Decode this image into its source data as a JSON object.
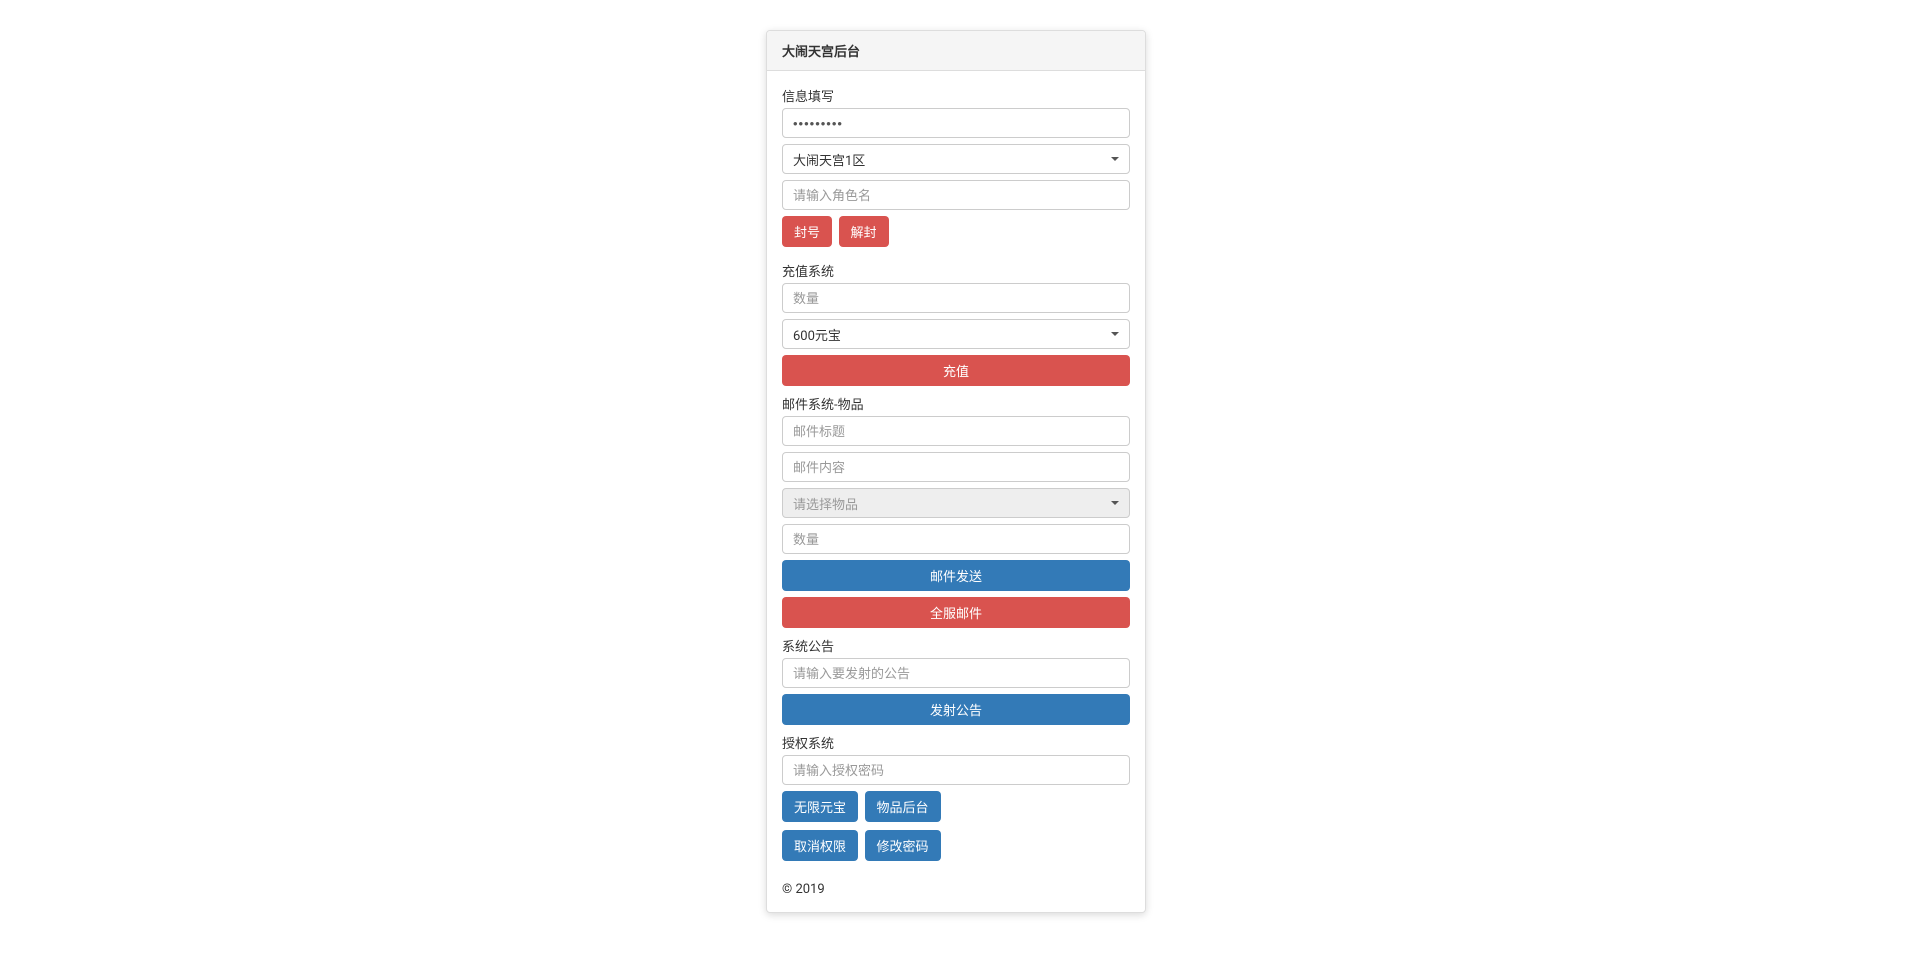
{
  "header": {
    "title": "大闹天宫后台"
  },
  "info_section": {
    "label": "信息填写",
    "password_value": "•••••••••",
    "server_select": "大闹天宫1区",
    "character_placeholder": "请输入角色名",
    "ban_button": "封号",
    "unban_button": "解封"
  },
  "recharge_section": {
    "label": "充值系统",
    "amount_placeholder": "数量",
    "package_select": "600元宝",
    "recharge_button": "充值"
  },
  "mail_section": {
    "label": "邮件系统-物品",
    "title_placeholder": "邮件标题",
    "content_placeholder": "邮件内容",
    "item_select": "请选择物品",
    "quantity_placeholder": "数量",
    "send_button": "邮件发送",
    "broadcast_button": "全服邮件"
  },
  "announce_section": {
    "label": "系统公告",
    "announce_placeholder": "请输入要发射的公告",
    "announce_button": "发射公告"
  },
  "auth_section": {
    "label": "授权系统",
    "auth_placeholder": "请输入授权密码",
    "unlimited_button": "无限元宝",
    "item_admin_button": "物品后台",
    "revoke_button": "取消权限",
    "change_pwd_button": "修改密码"
  },
  "footer": {
    "copyright": "© 2019"
  }
}
